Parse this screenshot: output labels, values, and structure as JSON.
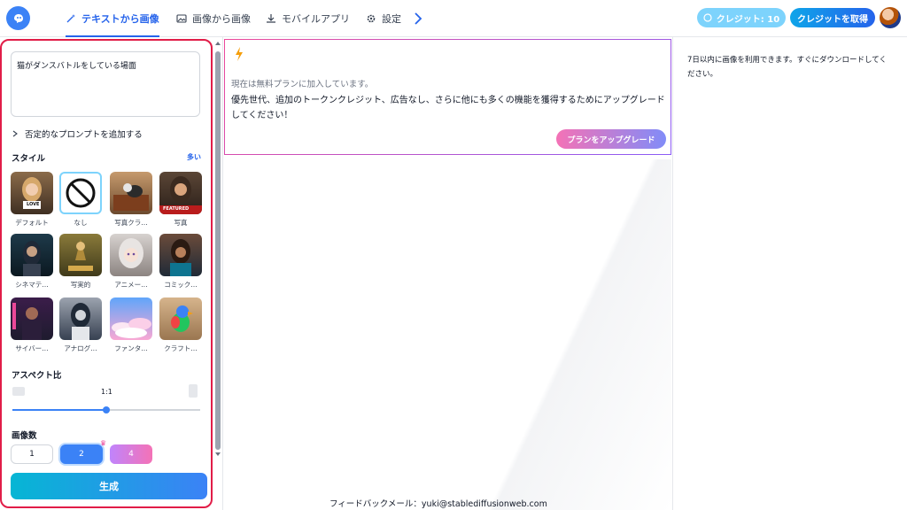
{
  "nav": {
    "items": [
      {
        "label": "テキストから画像",
        "icon": "wand-icon",
        "active": true
      },
      {
        "label": "画像から画像",
        "icon": "image-icon",
        "active": false
      },
      {
        "label": "モバイルアプリ",
        "icon": "download-icon",
        "active": false
      },
      {
        "label": "設定",
        "icon": "gear-icon",
        "active": false
      }
    ],
    "credit_label": "クレジット: 10",
    "get_credit_label": "クレジットを取得"
  },
  "left": {
    "prompt": "猫がダンスバトルをしている場面",
    "negative_prompt_label": "否定的なプロンプトを追加する",
    "style_label": "スタイル",
    "more_label": "多い",
    "styles": [
      {
        "caption": "デフォルト"
      },
      {
        "caption": "なし"
      },
      {
        "caption": "写真クラ…"
      },
      {
        "caption": "写真"
      },
      {
        "caption": "シネマテ…"
      },
      {
        "caption": "写実的"
      },
      {
        "caption": "アニメー…"
      },
      {
        "caption": "コミック…"
      },
      {
        "caption": "サイバー…"
      },
      {
        "caption": "アナログ…"
      },
      {
        "caption": "ファンタ…"
      },
      {
        "caption": "クラフト…"
      }
    ],
    "thumb_badges": {
      "love": "LOVE",
      "featured": "FEATURED"
    },
    "selected_style_index": 1,
    "aspect_label": "アスペクト比",
    "aspect_value": "1:1",
    "aspect_slider_fraction": 0.5,
    "count_label": "画像数",
    "counts": [
      "1",
      "2",
      "4"
    ],
    "selected_count": "2",
    "generate_label": "生成"
  },
  "center": {
    "plan_text": "現在は無料プランに加入しています。",
    "plan_desc": "優先世代、追加のトークンクレジット、広告なし、さらに他にも多くの機能を獲得するためにアップグレードしてください！",
    "upgrade_label": "プランをアップグレード",
    "footer": "フィードバックメール：yuki@stablediffusionweb.com"
  },
  "right": {
    "note": "7日以内に画像を利用できます。すぐにダウンロードしてください。"
  },
  "colors": {
    "accent": "#2563eb",
    "highlight_border": "#e11d48",
    "generate_gradient": [
      "#06b6d4",
      "#3b82f6"
    ]
  }
}
